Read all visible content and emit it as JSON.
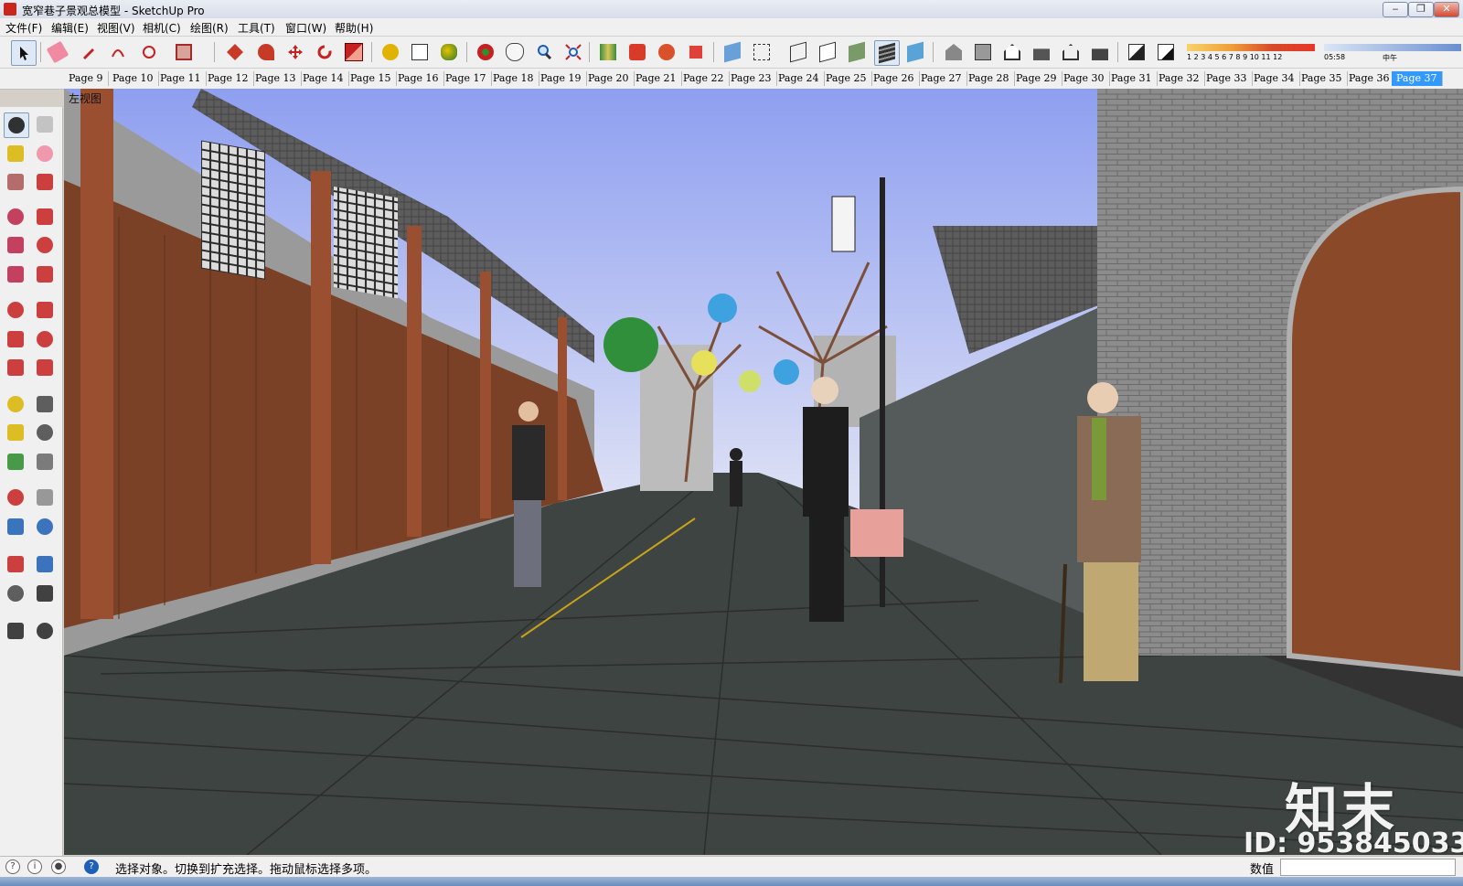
{
  "window": {
    "title": "宽窄巷子景观总模型 - SketchUp Pro",
    "minimize": "‒",
    "restore": "❐",
    "close": "✕"
  },
  "menu": [
    "文件(F)",
    "编辑(E)",
    "视图(V)",
    "相机(C)",
    "绘图(R)",
    "工具(T)",
    "窗口(W)",
    "帮助(H)"
  ],
  "toolbar": {
    "shadow_scale": "1 2 3 4 5 6 7 8 9 10 11 12",
    "time_left": "05:58",
    "time_right": "中午"
  },
  "page_tabs": [
    "Page 9",
    "Page 10",
    "Page 11",
    "Page 12",
    "Page 13",
    "Page 14",
    "Page 15",
    "Page 16",
    "Page 17",
    "Page 18",
    "Page 19",
    "Page 20",
    "Page 21",
    "Page 22",
    "Page 23",
    "Page 24",
    "Page 25",
    "Page 26",
    "Page 27",
    "Page 28",
    "Page 29",
    "Page 30",
    "Page 31",
    "Page 32",
    "Page 33",
    "Page 34",
    "Page 35",
    "Page 36",
    "Page 37"
  ],
  "active_tab": "Page 37",
  "viewport": {
    "scene_label": "左视图"
  },
  "status": {
    "hint": "选择对象。切换到扩充选择。拖动鼠标选择多项。",
    "measure_label": "数值",
    "measure_value": ""
  },
  "watermark": {
    "brand": "知末",
    "id": "ID: 953845033"
  },
  "colors": {
    "sky_top": "#8e9ff0",
    "sky_bottom": "#dfe2f5",
    "wood": "#7a4126",
    "pavement": "#3e4442",
    "brick": "#8c8c8c",
    "active_tab": "#3399ff"
  }
}
